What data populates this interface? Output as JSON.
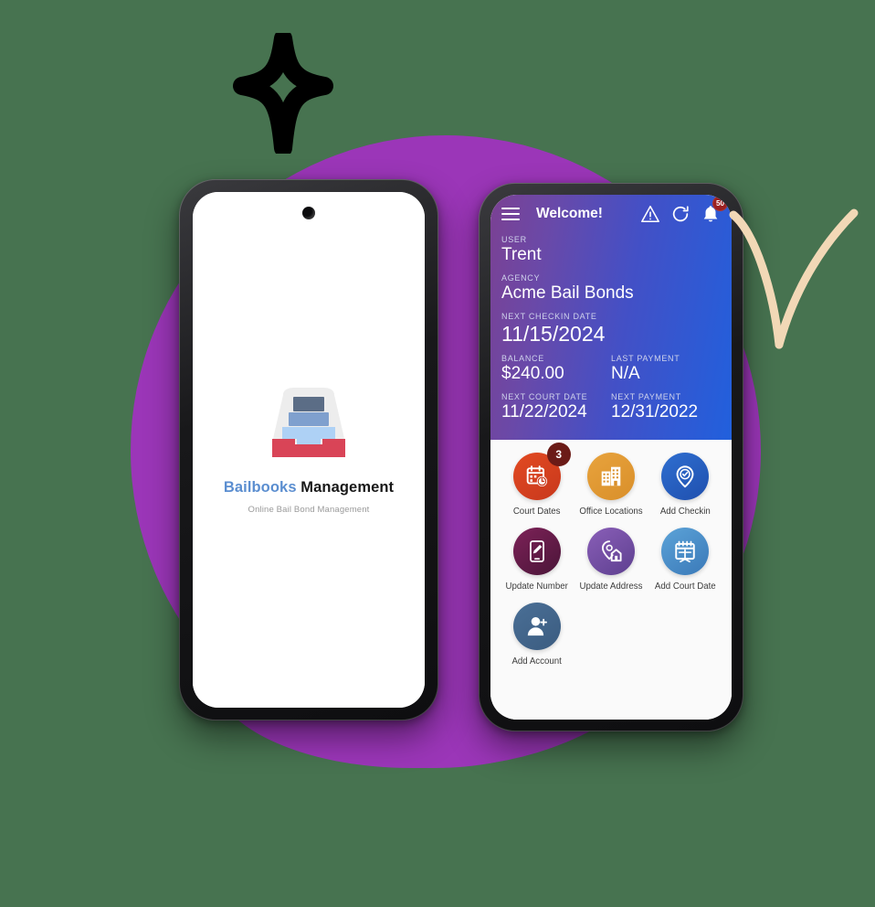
{
  "theme": {
    "background": "#477350",
    "blob_purple": "#9b36b8",
    "swoosh_beige": "#f2d8b6",
    "sparkle_black": "#000000",
    "header_gradient_start": "#7b4193",
    "header_gradient_end": "#2160dd"
  },
  "left_phone": {
    "splash": {
      "brand_first": "Bailbooks",
      "brand_second": "Management",
      "tagline": "Online Bail Bond Management",
      "logo_icon": "inbox-tray-icon"
    }
  },
  "right_phone": {
    "appbar": {
      "menu_icon": "hamburger-menu-icon",
      "title": "Welcome!",
      "warning_icon": "warning-triangle-icon",
      "refresh_icon": "refresh-icon",
      "bell_icon": "notification-bell-icon",
      "bell_badge": "50"
    },
    "fields": [
      {
        "label": "USER",
        "value": "Trent",
        "size": "normal"
      },
      {
        "label": "AGENCY",
        "value": "Acme Bail Bonds",
        "size": "normal"
      },
      {
        "label": "NEXT CHECKIN DATE",
        "value": "11/15/2024",
        "size": "big"
      }
    ],
    "field_rows": [
      [
        {
          "label": "BALANCE",
          "value": "$240.00"
        },
        {
          "label": "LAST PAYMENT",
          "value": "N/A"
        }
      ],
      [
        {
          "label": "NEXT COURT DATE",
          "value": "11/22/2024"
        },
        {
          "label": "NEXT PAYMENT",
          "value": "12/31/2022"
        }
      ]
    ],
    "tiles": [
      {
        "label": "Court Dates",
        "icon": "calendar-clock-icon",
        "color_from": "#e24a22",
        "color_to": "#c8381c",
        "badge": "3"
      },
      {
        "label": "Office Locations",
        "icon": "office-building-icon",
        "color_from": "#e8a33d",
        "color_to": "#d98f2a",
        "badge": null
      },
      {
        "label": "Add Checkin",
        "icon": "map-pin-check-icon",
        "color_from": "#2f6fd0",
        "color_to": "#1f4fae",
        "badge": null
      },
      {
        "label": "Update Number",
        "icon": "phone-edit-icon",
        "color_from": "#7d2258",
        "color_to": "#4a1538",
        "badge": null
      },
      {
        "label": "Update Address",
        "icon": "map-pin-home-icon",
        "color_from": "#8a5fb8",
        "color_to": "#5d3f8f",
        "badge": null
      },
      {
        "label": "Add Court Date",
        "icon": "calendar-add-icon",
        "color_from": "#5ca3d8",
        "color_to": "#3a79b8",
        "badge": null
      },
      {
        "label": "Add Account",
        "icon": "person-add-icon",
        "color_from": "#4a6f96",
        "color_to": "#3b5c80",
        "badge": null
      }
    ]
  }
}
